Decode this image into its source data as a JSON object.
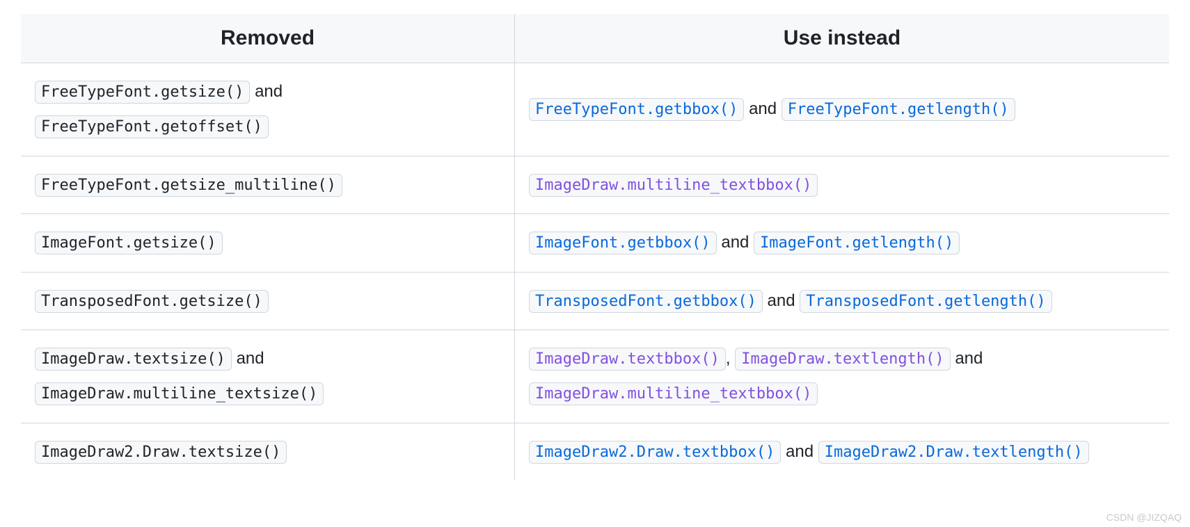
{
  "headers": {
    "col1": "Removed",
    "col2": "Use instead"
  },
  "rows": [
    {
      "removed": [
        {
          "t": "code",
          "v": "FreeTypeFont.getsize()"
        },
        {
          "t": "text",
          "v": " and "
        },
        {
          "t": "code",
          "v": "FreeTypeFont.getoffset()"
        }
      ],
      "use": [
        {
          "t": "code",
          "cls": "link-blue",
          "v": "FreeTypeFont.getbbox()"
        },
        {
          "t": "text",
          "v": " and "
        },
        {
          "t": "code",
          "cls": "link-blue",
          "v": "FreeTypeFont.getlength()"
        }
      ]
    },
    {
      "removed": [
        {
          "t": "code",
          "v": "FreeTypeFont.getsize_multiline()"
        }
      ],
      "use": [
        {
          "t": "code",
          "cls": "link-purple",
          "v": "ImageDraw.multiline_textbbox()"
        }
      ]
    },
    {
      "removed": [
        {
          "t": "code",
          "v": "ImageFont.getsize()"
        }
      ],
      "use": [
        {
          "t": "code",
          "cls": "link-blue",
          "v": "ImageFont.getbbox()"
        },
        {
          "t": "text",
          "v": " and "
        },
        {
          "t": "code",
          "cls": "link-blue",
          "v": "ImageFont.getlength()"
        }
      ]
    },
    {
      "removed": [
        {
          "t": "code",
          "v": "TransposedFont.getsize()"
        }
      ],
      "use": [
        {
          "t": "code",
          "cls": "link-blue",
          "v": "TransposedFont.getbbox()"
        },
        {
          "t": "text",
          "v": " and "
        },
        {
          "t": "code",
          "cls": "link-blue",
          "v": "TransposedFont.getlength()"
        }
      ]
    },
    {
      "removed": [
        {
          "t": "code",
          "v": "ImageDraw.textsize()"
        },
        {
          "t": "text",
          "v": " and "
        },
        {
          "t": "code",
          "v": "ImageDraw.multiline_textsize()"
        }
      ],
      "use": [
        {
          "t": "code",
          "cls": "link-purple",
          "v": "ImageDraw.textbbox()"
        },
        {
          "t": "text",
          "v": ", "
        },
        {
          "t": "code",
          "cls": "link-purple",
          "v": "ImageDraw.textlength()"
        },
        {
          "t": "text",
          "v": " and "
        },
        {
          "t": "code",
          "cls": "link-purple",
          "v": "ImageDraw.multiline_textbbox()"
        }
      ]
    },
    {
      "removed": [
        {
          "t": "code",
          "v": "ImageDraw2.Draw.textsize()"
        }
      ],
      "use": [
        {
          "t": "code",
          "cls": "link-blue",
          "v": "ImageDraw2.Draw.textbbox()"
        },
        {
          "t": "text",
          "v": " and "
        },
        {
          "t": "code",
          "cls": "link-blue",
          "v": "ImageDraw2.Draw.textlength()"
        }
      ]
    }
  ],
  "watermark": "CSDN @JIZQAQ"
}
